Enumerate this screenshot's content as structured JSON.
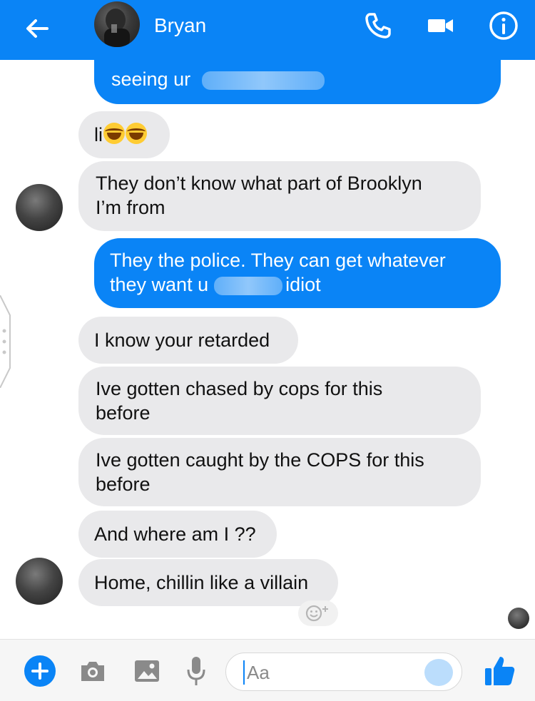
{
  "header": {
    "contact_name": "Bryan",
    "colors": {
      "bar": "#0a84f6",
      "icon": "#ffffff"
    },
    "icons": [
      "back-arrow-icon",
      "phone-icon",
      "video-camera-icon",
      "info-icon"
    ]
  },
  "messages": [
    {
      "side": "outgoing",
      "text": "seeing ur"
    },
    {
      "side": "incoming",
      "text": "li"
    },
    {
      "side": "incoming",
      "line1": "They don’t know what part of Brooklyn",
      "line2": "I’m from"
    },
    {
      "side": "outgoing",
      "line1": "They the police. They can get whatever",
      "line2_a": "they want u",
      "line2_b": "idiot"
    },
    {
      "side": "incoming",
      "text": "I know your retarded"
    },
    {
      "side": "incoming",
      "line1": "Ive gotten chased by cops for this",
      "line2": "before"
    },
    {
      "side": "incoming",
      "line1": "Ive gotten caught by the COPS for this",
      "line2": "before"
    },
    {
      "side": "incoming",
      "text": "And where am I ??"
    },
    {
      "side": "incoming",
      "text": "Home, chillin like a villain"
    }
  ],
  "composer": {
    "placeholder": "Aa",
    "icons": [
      "plus-icon",
      "camera-icon",
      "image-icon",
      "microphone-icon",
      "emoji-icon",
      "thumbs-up-icon"
    ]
  }
}
